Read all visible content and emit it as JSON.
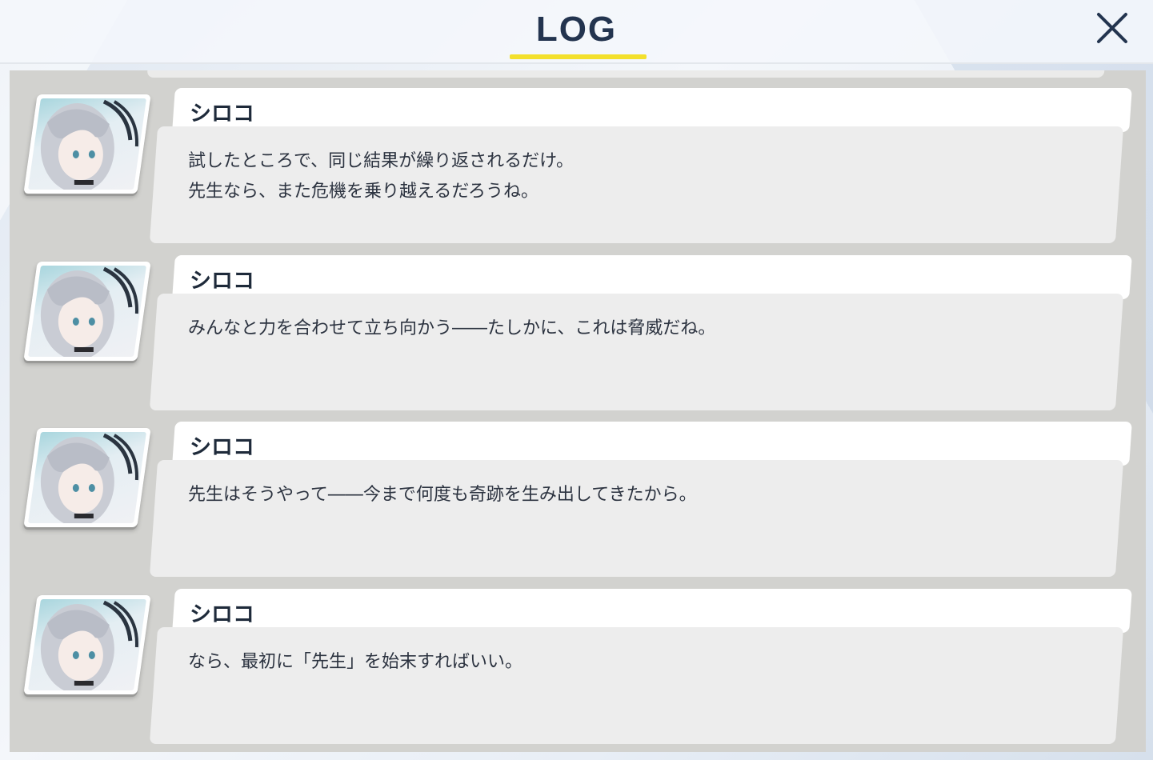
{
  "header": {
    "title": "LOG",
    "close_icon": "close-icon",
    "accent_color": "#f3e02c"
  },
  "entries": [
    {
      "speaker": "シロコ",
      "portrait_icon": "character-portrait",
      "lines": [
        "試したところで、同じ結果が繰り返されるだけ。",
        "先生なら、また危機を乗り越えるだろうね。"
      ]
    },
    {
      "speaker": "シロコ",
      "portrait_icon": "character-portrait",
      "lines": [
        "みんなと力を合わせて立ち向かう――たしかに、これは脅威だね。"
      ]
    },
    {
      "speaker": "シロコ",
      "portrait_icon": "character-portrait",
      "lines": [
        "先生はそうやって――今まで何度も奇跡を生み出してきたから。"
      ]
    },
    {
      "speaker": "シロコ",
      "portrait_icon": "character-portrait",
      "lines": [
        "なら、最初に「先生」を始末すればいい。"
      ]
    }
  ]
}
